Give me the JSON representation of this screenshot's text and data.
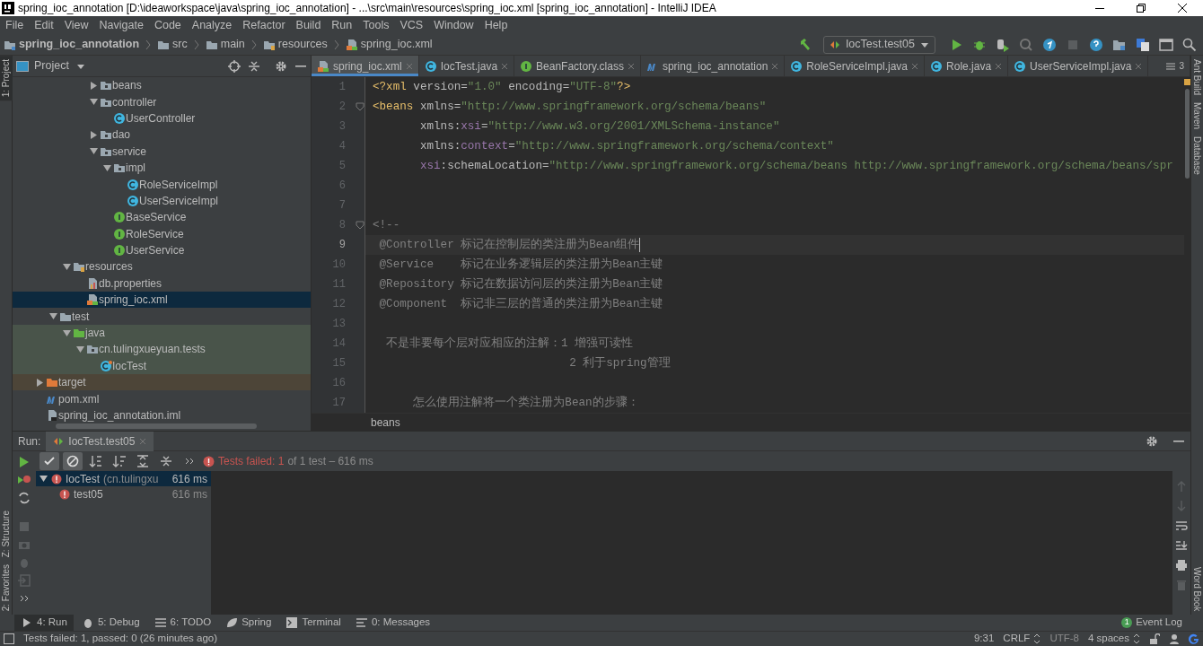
{
  "window": {
    "title": "spring_ioc_annotation [D:\\ideaworkspace\\java\\spring_ioc_annotation] - ...\\src\\main\\resources\\spring_ioc.xml [spring_ioc_annotation] - IntelliJ IDEA"
  },
  "menu": [
    "File",
    "Edit",
    "View",
    "Navigate",
    "Code",
    "Analyze",
    "Refactor",
    "Build",
    "Run",
    "Tools",
    "VCS",
    "Window",
    "Help"
  ],
  "breadcrumb": [
    {
      "label": "spring_ioc_annotation",
      "kind": "module"
    },
    {
      "label": "src",
      "kind": "folder"
    },
    {
      "label": "main",
      "kind": "folder"
    },
    {
      "label": "resources",
      "kind": "resources"
    },
    {
      "label": "spring_ioc.xml",
      "kind": "xml"
    }
  ],
  "run_config": "IocTest.test05",
  "left_strip": {
    "top": [
      {
        "label": "1: Project",
        "selected": true
      }
    ],
    "bottom": [
      {
        "label": "Z: Structure",
        "selected": false
      },
      {
        "label": "2: Favorites",
        "selected": false
      }
    ]
  },
  "right_strip": {
    "top": [
      {
        "label": "Ant Build",
        "selected": false
      },
      {
        "label": "Maven",
        "selected": false
      },
      {
        "label": "Database",
        "selected": false
      }
    ],
    "bottom": [
      {
        "label": "Word Book",
        "selected": false
      }
    ]
  },
  "project": {
    "title": "Project",
    "tree": [
      {
        "children": [
          {
            "children": [
              {
                "children": [
                  {
                    "children": [
                      {
                        "label": "beans",
                        "kind": "package",
                        "expanded": false,
                        "selected": false
                      },
                      {
                        "label": "controller",
                        "kind": "package",
                        "expanded": true,
                        "selected": false,
                        "children": [
                          {
                            "label": "UserController",
                            "kind": "class",
                            "selected": false
                          }
                        ]
                      },
                      {
                        "label": "dao",
                        "kind": "package",
                        "expanded": false,
                        "selected": false
                      },
                      {
                        "label": "service",
                        "kind": "package",
                        "expanded": true,
                        "selected": false,
                        "children": [
                          {
                            "label": "impl",
                            "kind": "package",
                            "expanded": true,
                            "selected": false,
                            "children": [
                              {
                                "label": "RoleServiceImpl",
                                "kind": "class",
                                "selected": false
                              },
                              {
                                "label": "UserServiceImpl",
                                "kind": "class",
                                "selected": false
                              }
                            ]
                          },
                          {
                            "label": "BaseService",
                            "kind": "interface",
                            "selected": false
                          },
                          {
                            "label": "RoleService",
                            "kind": "interface",
                            "selected": false
                          },
                          {
                            "label": "UserService",
                            "kind": "interface",
                            "selected": false
                          }
                        ]
                      }
                    ]
                  }
                ]
              },
              {
                "label": "resources",
                "kind": "resources",
                "expanded": true,
                "selected": false,
                "children": [
                  {
                    "label": "db.properties",
                    "kind": "properties",
                    "selected": false
                  },
                  {
                    "label": "spring_ioc.xml",
                    "kind": "xml",
                    "selected": true
                  }
                ]
              }
            ]
          },
          {
            "label": "test",
            "kind": "folder",
            "expanded": true,
            "selected": false,
            "children": [
              {
                "label": "java",
                "kind": "testroot",
                "expanded": true,
                "selected": false,
                "color": "#49544a",
                "children": [
                  {
                    "label": "cn.tulingxueyuan.tests",
                    "kind": "package",
                    "expanded": true,
                    "selected": false,
                    "color": "#49544a",
                    "children": [
                      {
                        "label": "IocTest",
                        "kind": "testclass",
                        "selected": false,
                        "color": "#49544a"
                      }
                    ]
                  }
                ]
              }
            ]
          }
        ]
      },
      {
        "label": "target",
        "kind": "excluded",
        "expanded": false,
        "selected": false,
        "color": "#4d4538"
      },
      {
        "label": "pom.xml",
        "kind": "maven",
        "selected": false
      },
      {
        "label": "spring_ioc_annotation.iml",
        "kind": "iml",
        "selected": false
      }
    ]
  },
  "tabs": [
    {
      "label": "spring_ioc.xml",
      "kind": "xml",
      "selected": true
    },
    {
      "label": "IocTest.java",
      "kind": "class",
      "selected": false
    },
    {
      "label": "BeanFactory.class",
      "kind": "interface",
      "selected": false
    },
    {
      "label": "spring_ioc_annotation",
      "kind": "maven",
      "selected": false
    },
    {
      "label": "RoleServiceImpl.java",
      "kind": "class",
      "selected": false
    },
    {
      "label": "Role.java",
      "kind": "class",
      "selected": false
    },
    {
      "label": "UserServiceImpl.java",
      "kind": "class",
      "selected": false
    }
  ],
  "tabs_overflow": "3",
  "editor": {
    "lines": [
      {
        "number": "1",
        "current": false,
        "fold": false,
        "segments": [
          {
            "kind": "tag",
            "text": "<?xml "
          },
          {
            "kind": "attr",
            "text": "version="
          },
          {
            "kind": "value",
            "text": "\"1.0\""
          },
          {
            "kind": "attr",
            "text": " encoding="
          },
          {
            "kind": "value",
            "text": "\"UTF-8\""
          },
          {
            "kind": "tag",
            "text": "?>"
          }
        ]
      },
      {
        "number": "2",
        "current": false,
        "fold": true,
        "segments": [
          {
            "kind": "tag",
            "text": "<beans "
          },
          {
            "kind": "attr",
            "text": "xmlns="
          },
          {
            "kind": "value",
            "text": "\"http://www.springframework.org/schema/beans\""
          }
        ]
      },
      {
        "number": "3",
        "current": false,
        "fold": false,
        "segments": [
          {
            "kind": "attr",
            "text": "       xmlns:"
          },
          {
            "kind": "ns",
            "text": "xsi"
          },
          {
            "kind": "attr",
            "text": "="
          },
          {
            "kind": "value",
            "text": "\"http://www.w3.org/2001/XMLSchema-instance\""
          }
        ]
      },
      {
        "number": "4",
        "current": false,
        "fold": false,
        "segments": [
          {
            "kind": "attr",
            "text": "       xmlns:"
          },
          {
            "kind": "ns",
            "text": "context"
          },
          {
            "kind": "attr",
            "text": "="
          },
          {
            "kind": "value",
            "text": "\"http://www.springframework.org/schema/context\""
          }
        ]
      },
      {
        "number": "5",
        "current": false,
        "fold": false,
        "segments": [
          {
            "kind": "ns",
            "text": "       xsi"
          },
          {
            "kind": "attr",
            "text": ":schemaLocation="
          },
          {
            "kind": "value",
            "text": "\"http://www.springframework.org/schema/beans http://www.springframework.org/schema/beans/spr"
          }
        ]
      },
      {
        "number": "6",
        "current": false,
        "fold": false
      },
      {
        "number": "7",
        "current": false,
        "fold": false
      },
      {
        "number": "8",
        "current": false,
        "fold": true,
        "segments": [
          {
            "kind": "comment",
            "text": "<!--"
          }
        ]
      },
      {
        "number": "9",
        "current": true,
        "fold": false,
        "segments": [
          {
            "kind": "comment",
            "text": " @Controller 标记在控制层的类注册为Bean组件"
          }
        ]
      },
      {
        "number": "10",
        "current": false,
        "fold": false,
        "segments": [
          {
            "kind": "comment",
            "text": " @Service    标记在业务逻辑层的类注册为Bean主键"
          }
        ]
      },
      {
        "number": "11",
        "current": false,
        "fold": false,
        "segments": [
          {
            "kind": "comment",
            "text": " @Repository 标记在数据访问层的类注册为Bean主键"
          }
        ]
      },
      {
        "number": "12",
        "current": false,
        "fold": false,
        "segments": [
          {
            "kind": "comment",
            "text": " @Component  标记非三层的普通的类注册为Bean主键"
          }
        ]
      },
      {
        "number": "13",
        "current": false,
        "fold": false
      },
      {
        "number": "14",
        "current": false,
        "fold": false,
        "segments": [
          {
            "kind": "comment",
            "text": "  不是非要每个层对应相应的注解：1 增强可读性"
          }
        ]
      },
      {
        "number": "15",
        "current": false,
        "fold": false,
        "segments": [
          {
            "kind": "comment",
            "text": "                             2 利于spring管理"
          }
        ]
      },
      {
        "number": "16",
        "current": false,
        "fold": false
      },
      {
        "number": "17",
        "current": false,
        "fold": false,
        "segments": [
          {
            "kind": "comment",
            "text": "      怎么使用注解将一个类注册为Bean的步骤："
          }
        ]
      }
    ],
    "footer": "beans"
  },
  "run": {
    "label": "Run:",
    "tab": "IocTest.test05",
    "status_failed": "Tests failed: 1",
    "status_rest": "of 1 test – 616 ms",
    "tree": [
      {
        "label": "IocTest",
        "detail": "(cn.tulingxu",
        "time": "616 ms",
        "selected": true,
        "expanded": true,
        "children": [
          {
            "label": "test05",
            "time": "616 ms",
            "selected": false
          }
        ]
      }
    ]
  },
  "tool_tabs": [
    {
      "label": "4: Run",
      "kind": "run",
      "selected": true
    },
    {
      "label": "5: Debug",
      "kind": "debug",
      "selected": false
    },
    {
      "label": "6: TODO",
      "kind": "todo",
      "selected": false
    },
    {
      "label": "Spring",
      "kind": "spring",
      "selected": false
    },
    {
      "label": "Terminal",
      "kind": "terminal",
      "selected": false
    },
    {
      "label": "0: Messages",
      "kind": "messages",
      "selected": false
    }
  ],
  "event_log": {
    "label": "Event Log",
    "count": "1"
  },
  "status_bar": {
    "message": "Tests failed: 1, passed: 0 (26 minutes ago)",
    "position": "9:31",
    "line_separator": "CRLF",
    "encoding": "UTF-8",
    "indent": "4 spaces"
  }
}
